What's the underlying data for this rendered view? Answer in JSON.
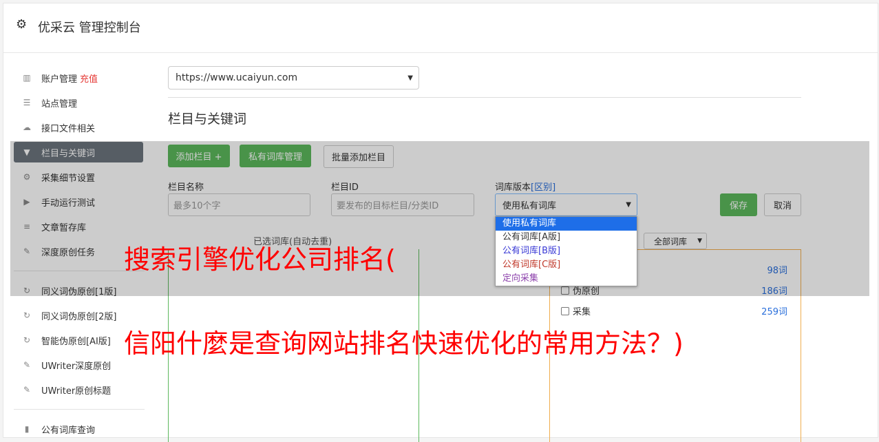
{
  "header": {
    "title": "优采云 管理控制台",
    "icon": "gear-icon"
  },
  "sidebar": {
    "items": [
      {
        "label": "账户管理",
        "badge": "充值",
        "icon": "bar-chart-icon"
      },
      {
        "label": "站点管理",
        "icon": "server-icon"
      },
      {
        "label": "接口文件相关",
        "icon": "cloud-upload-icon"
      },
      {
        "label": "栏目与关键词",
        "icon": "filter-icon",
        "active": true
      },
      {
        "label": "采集细节设置",
        "icon": "cogs-icon"
      },
      {
        "label": "手动运行测试",
        "icon": "play-circle-icon"
      },
      {
        "label": "文章暂存库",
        "icon": "database-icon"
      },
      {
        "label": "深度原创任务",
        "icon": "edit-icon"
      },
      {
        "label": "同义词伪原创[1版]",
        "icon": "refresh-icon"
      },
      {
        "label": "同义词伪原创[2版]",
        "icon": "refresh-icon"
      },
      {
        "label": "智能伪原创[AI版]",
        "icon": "refresh-icon"
      },
      {
        "label": "UWriter深度原创",
        "icon": "edit-icon"
      },
      {
        "label": "UWriter原创标题",
        "icon": "edit-icon"
      },
      {
        "label": "公有词库查询",
        "icon": "book-icon"
      }
    ]
  },
  "main": {
    "site_select": "https://www.ucaiyun.com",
    "section_title": "栏目与关键词",
    "buttons": {
      "add_column": "添加栏目 +",
      "private_lib": "私有词库管理",
      "batch_add": "批量添加栏目",
      "save": "保存",
      "cancel": "取消"
    },
    "form": {
      "column_name_label": "栏目名称",
      "column_name_placeholder": "最多10个字",
      "column_id_label": "栏目ID",
      "column_id_placeholder": "要发布的目标栏目/分类ID",
      "lib_version_label": "词库版本",
      "lib_version_link": "[区别]",
      "lib_version_value": "使用私有词库"
    },
    "dropdown_options": [
      {
        "label": "使用私有词库",
        "color": "#ffffff"
      },
      {
        "label": "公有词库[A版]",
        "color": "#333333"
      },
      {
        "label": "公有词库[B版]",
        "color": "#3a3ad6"
      },
      {
        "label": "公有词库[C版]",
        "color": "#c0392b"
      },
      {
        "label": "定向采集",
        "color": "#8e44ad"
      }
    ],
    "selected_lib_label": "已选词库(自动去重)",
    "filter_select": "全部词库",
    "lib_rows": [
      {
        "label": "伪原创",
        "count": "186词"
      },
      {
        "label": "采集",
        "count": "259词"
      }
    ],
    "first_count": "98词"
  },
  "watermark": {
    "line1": "搜索引擎优化公司排名(",
    "line2": "信阳什麼是查询网站排名快速优化的常用方法？)"
  }
}
